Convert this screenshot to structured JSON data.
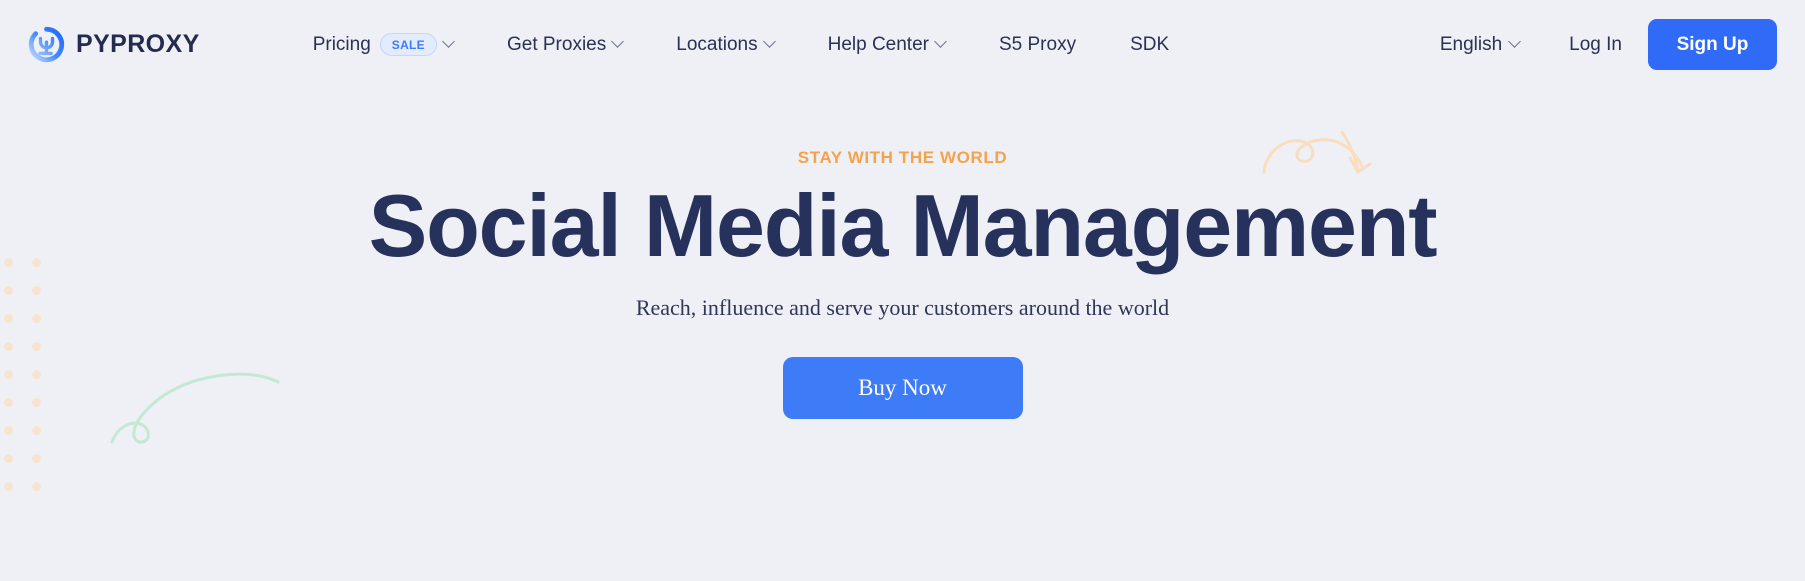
{
  "theme": {
    "background": "#eff0f6",
    "navy": "#27325c",
    "accent_blue": "#2f6bf6",
    "cta_blue": "#3d7bf7",
    "eyebrow_orange": "#f5a24b",
    "badge_bg": "#e3ecff",
    "badge_text": "#3b7bfd",
    "dot_peach": "#f7e4ce",
    "swoosh_green": "#bfe8d2",
    "swoosh_orange": "#f6d6b4"
  },
  "header": {
    "brand": {
      "name": "PYPROXY",
      "logo_icon": "pyproxy-circle-logo-icon"
    },
    "nav_items": [
      {
        "label": "Pricing",
        "badge": "SALE",
        "has_dropdown": true
      },
      {
        "label": "Get Proxies",
        "badge": null,
        "has_dropdown": true
      },
      {
        "label": "Locations",
        "badge": null,
        "has_dropdown": true
      },
      {
        "label": "Help Center",
        "badge": null,
        "has_dropdown": true
      },
      {
        "label": "S5 Proxy",
        "badge": null,
        "has_dropdown": false
      },
      {
        "label": "SDK",
        "badge": null,
        "has_dropdown": false
      }
    ],
    "language": {
      "label": "English",
      "has_dropdown": true
    },
    "login_label": "Log In",
    "signup_label": "Sign Up"
  },
  "hero": {
    "eyebrow": "STAY WITH THE WORLD",
    "title": "Social Media Management",
    "subtitle": "Reach, influence and serve your customers around the world",
    "cta_label": "Buy Now"
  },
  "decorations": {
    "dot_grid_columns": 2,
    "dot_grid_rows": 9,
    "left_swoosh_icon": "green-curl-swoosh-icon",
    "right_swoosh_icon": "orange-curl-swoosh-icon"
  }
}
